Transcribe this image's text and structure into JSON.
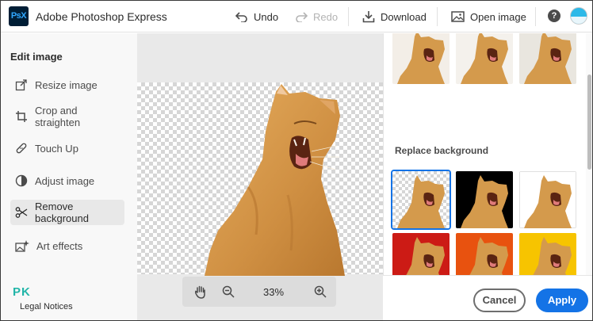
{
  "app": {
    "logo_text": "PsX",
    "title": "Adobe Photoshop Express"
  },
  "toolbar": {
    "undo_label": "Undo",
    "redo_label": "Redo",
    "download_label": "Download",
    "open_image_label": "Open image",
    "help_glyph": "?"
  },
  "sidebar": {
    "title": "Edit image",
    "items": [
      {
        "label": "Resize image",
        "icon": "resize-icon",
        "active": false
      },
      {
        "label": "Crop and straighten",
        "icon": "crop-icon",
        "active": false
      },
      {
        "label": "Touch Up",
        "icon": "bandage-icon",
        "active": false
      },
      {
        "label": "Adjust image",
        "icon": "adjust-icon",
        "active": false
      },
      {
        "label": "Remove background",
        "icon": "scissors-icon",
        "active": true
      },
      {
        "label": "Art effects",
        "icon": "sparkle-image-icon",
        "active": false
      }
    ],
    "watermark": "PK",
    "legal": "Legal Notices"
  },
  "zoom": {
    "value": "33%"
  },
  "panel": {
    "top_thumbs": [
      "#f3eee7",
      "#f4f1ec",
      "#e9e6df"
    ],
    "section_title": "Replace background",
    "backgrounds": [
      {
        "name": "transparent",
        "color": "checker",
        "selected": true
      },
      {
        "name": "black",
        "color": "#000000",
        "selected": false
      },
      {
        "name": "white",
        "color": "#ffffff",
        "selected": false
      },
      {
        "name": "red",
        "color": "#cc1b15",
        "selected": false
      },
      {
        "name": "orange",
        "color": "#e8520f",
        "selected": false
      },
      {
        "name": "yellow",
        "color": "#f7c400",
        "selected": false
      }
    ]
  },
  "actions": {
    "cancel_label": "Cancel",
    "apply_label": "Apply"
  },
  "colors": {
    "accent": "#1473e6",
    "brand": "#001e36",
    "cat": "#d49a4c"
  }
}
